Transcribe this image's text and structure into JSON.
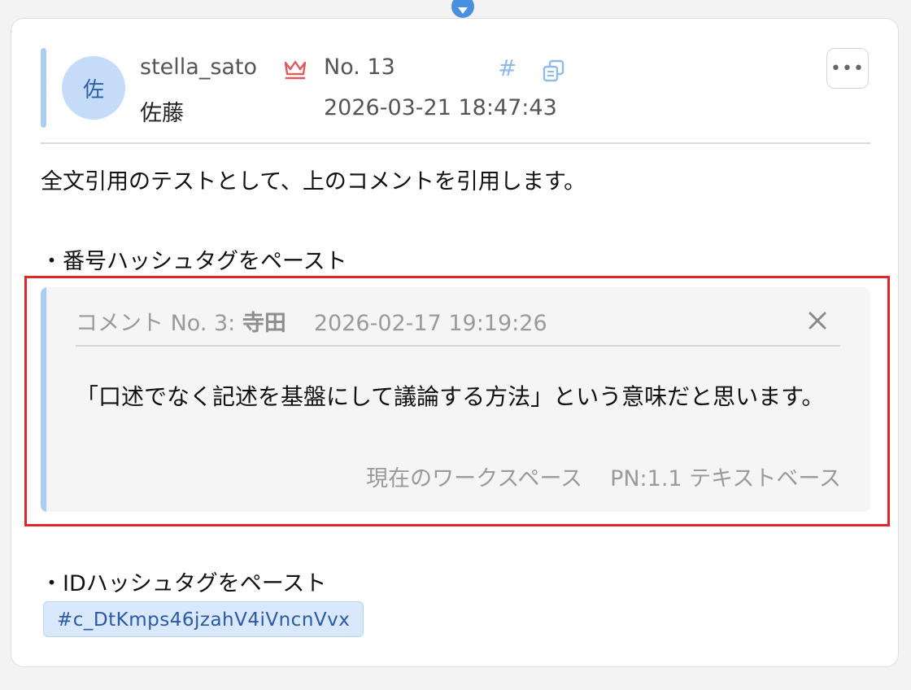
{
  "comment": {
    "avatar_initial": "佐",
    "username": "stella_sato",
    "display_name": "佐藤",
    "number": "No. 13",
    "timestamp": "2026-03-21 18:47:43",
    "hash_symbol": "#",
    "more_label": "•••",
    "body": {
      "line1": "全文引用のテストとして、上のコメントを引用します。",
      "line2": "・番号ハッシュタグをペースト",
      "line3": "・IDハッシュタグをペースト"
    },
    "quote": {
      "prefix": "コメント No. 3: ",
      "author": "寺田",
      "timestamp": "2026-02-17 19:19:26",
      "text": "「口述でなく記述を基盤にして議論する方法」という意味だと思います。",
      "workspace": "現在のワークスペース",
      "pn": "PN:1.1 テキストベース"
    },
    "id_hashtag": "#c_DtKmps46jzahV4iVncnVvx"
  },
  "colors": {
    "accent_blue": "#a9cdf4",
    "crown_red": "#e05b5b",
    "highlight_red": "#e0252d",
    "chip_text": "#2a5aa5"
  }
}
